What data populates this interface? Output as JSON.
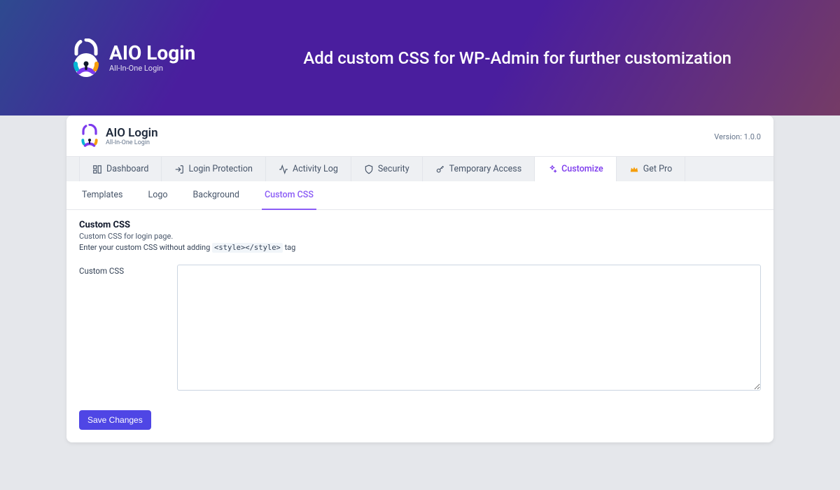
{
  "hero": {
    "logo_title": "AIO Login",
    "logo_sub": "All-In-One Login",
    "headline": "Add custom CSS for WP-Admin for further customization"
  },
  "card": {
    "logo_title": "AIO Login",
    "logo_sub": "All-In-One Login",
    "version": "Version: 1.0.0"
  },
  "tabs_primary": [
    {
      "label": "Dashboard"
    },
    {
      "label": "Login Protection"
    },
    {
      "label": "Activity Log"
    },
    {
      "label": "Security"
    },
    {
      "label": "Temporary Access"
    },
    {
      "label": "Customize"
    },
    {
      "label": "Get Pro"
    }
  ],
  "tabs_secondary": [
    {
      "label": "Templates"
    },
    {
      "label": "Logo"
    },
    {
      "label": "Background"
    },
    {
      "label": "Custom CSS"
    }
  ],
  "panel": {
    "title": "Custom CSS",
    "subtitle": "Custom CSS for login page.",
    "hint_prefix": "Enter your custom CSS without adding ",
    "hint_tag": "<style></style>",
    "hint_suffix": " tag",
    "field_label": "Custom CSS",
    "textarea_value": "",
    "save_button": "Save Changes"
  }
}
